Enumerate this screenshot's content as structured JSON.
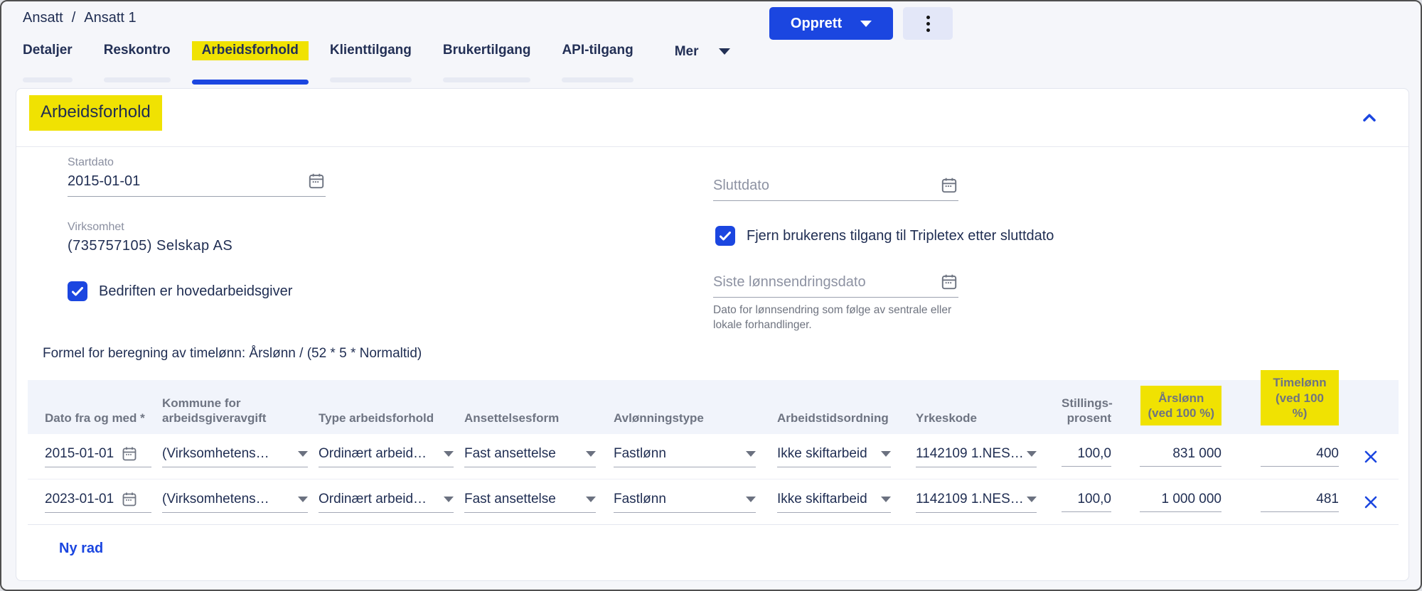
{
  "breadcrumb": {
    "parent": "Ansatt",
    "separator": "/",
    "current": "Ansatt 1"
  },
  "actions": {
    "create_label": "Opprett"
  },
  "tabs": [
    {
      "label": "Detaljer",
      "active": false
    },
    {
      "label": "Reskontro",
      "active": false
    },
    {
      "label": "Arbeidsforhold",
      "active": true,
      "highlighted": true
    },
    {
      "label": "Klienttilgang",
      "active": false
    },
    {
      "label": "Brukertilgang",
      "active": false
    },
    {
      "label": "API-tilgang",
      "active": false
    },
    {
      "label": "Mer",
      "active": false,
      "has_dropdown": true
    }
  ],
  "panel": {
    "title": "Arbeidsforhold",
    "form": {
      "startdato": {
        "label": "Startdato",
        "value": "2015-01-01"
      },
      "sluttdato": {
        "placeholder": "Sluttdato",
        "value": ""
      },
      "virksomhet": {
        "label": "Virksomhet",
        "value": "(735757105) Selskap AS"
      },
      "hovedarbeidsgiver": {
        "label": "Bedriften er hovedarbeidsgiver",
        "checked": true
      },
      "fjern_tilgang": {
        "label": "Fjern brukerens tilgang til Tripletex etter sluttdato",
        "checked": true
      },
      "siste": {
        "placeholder": "Siste lønnsendringsdato",
        "value": "",
        "help": "Dato for lønnsendring som følge av sentrale eller\nlokale forhandlinger."
      }
    },
    "formula": "Formel for beregning av timelønn: Årslønn / (52 * 5 * Normaltid)",
    "table": {
      "columns": [
        {
          "label": "Dato fra og med *",
          "highlighted": false
        },
        {
          "label": "Kommune for\narbeidsgiveravgift",
          "highlighted": false
        },
        {
          "label": "Type arbeidsforhold",
          "highlighted": false
        },
        {
          "label": "Ansettelsesform",
          "highlighted": false
        },
        {
          "label": "Avlønningstype",
          "highlighted": false
        },
        {
          "label": "Arbeidstidsordning",
          "highlighted": false
        },
        {
          "label": "Yrkeskode",
          "highlighted": false
        },
        {
          "label": "Stillings-\nprosent",
          "highlighted": false
        },
        {
          "label": "Årslønn\n(ved 100 %)",
          "highlighted": true
        },
        {
          "label": "Timelønn\n(ved 100 %)",
          "highlighted": true
        }
      ],
      "rows": [
        {
          "date": "2015-01-01",
          "kommune": "(Virksomhetens…",
          "type": "Ordinært arbeid…",
          "form": "Fast ansettelse",
          "avlonning": "Fastlønn",
          "arbeidstid": "Ikke skiftarbeid",
          "yrkeskode": "1142109 1.NES…",
          "prosent": "100,0",
          "arslonn": "831 000",
          "timelonn": "400"
        },
        {
          "date": "2023-01-01",
          "kommune": "(Virksomhetens…",
          "type": "Ordinært arbeid…",
          "form": "Fast ansettelse",
          "avlonning": "Fastlønn",
          "arbeidstid": "Ikke skiftarbeid",
          "yrkeskode": "1142109 1.NES…",
          "prosent": "100,0",
          "arslonn": "1 000 000",
          "timelonn": "481"
        }
      ],
      "new_row_label": "Ny rad"
    }
  },
  "icons": {
    "create_caret": "chevron-down",
    "more_menu": "kebab-vertical-dots",
    "mer_caret": "chevron-down",
    "collapse_section": "chevron-up",
    "date_fields": "calendar",
    "selects": "caret-down",
    "checkbox_state": "checkmark",
    "row_delete": "close-x"
  },
  "colors": {
    "primary_blue": "#1b46e0",
    "highlight_yellow": "#f0e202",
    "text_navy": "#1f2d52",
    "label_gray": "#8a8fa0",
    "table_header_bg": "#f1f4fb",
    "page_bg": "#f5f6fa"
  }
}
